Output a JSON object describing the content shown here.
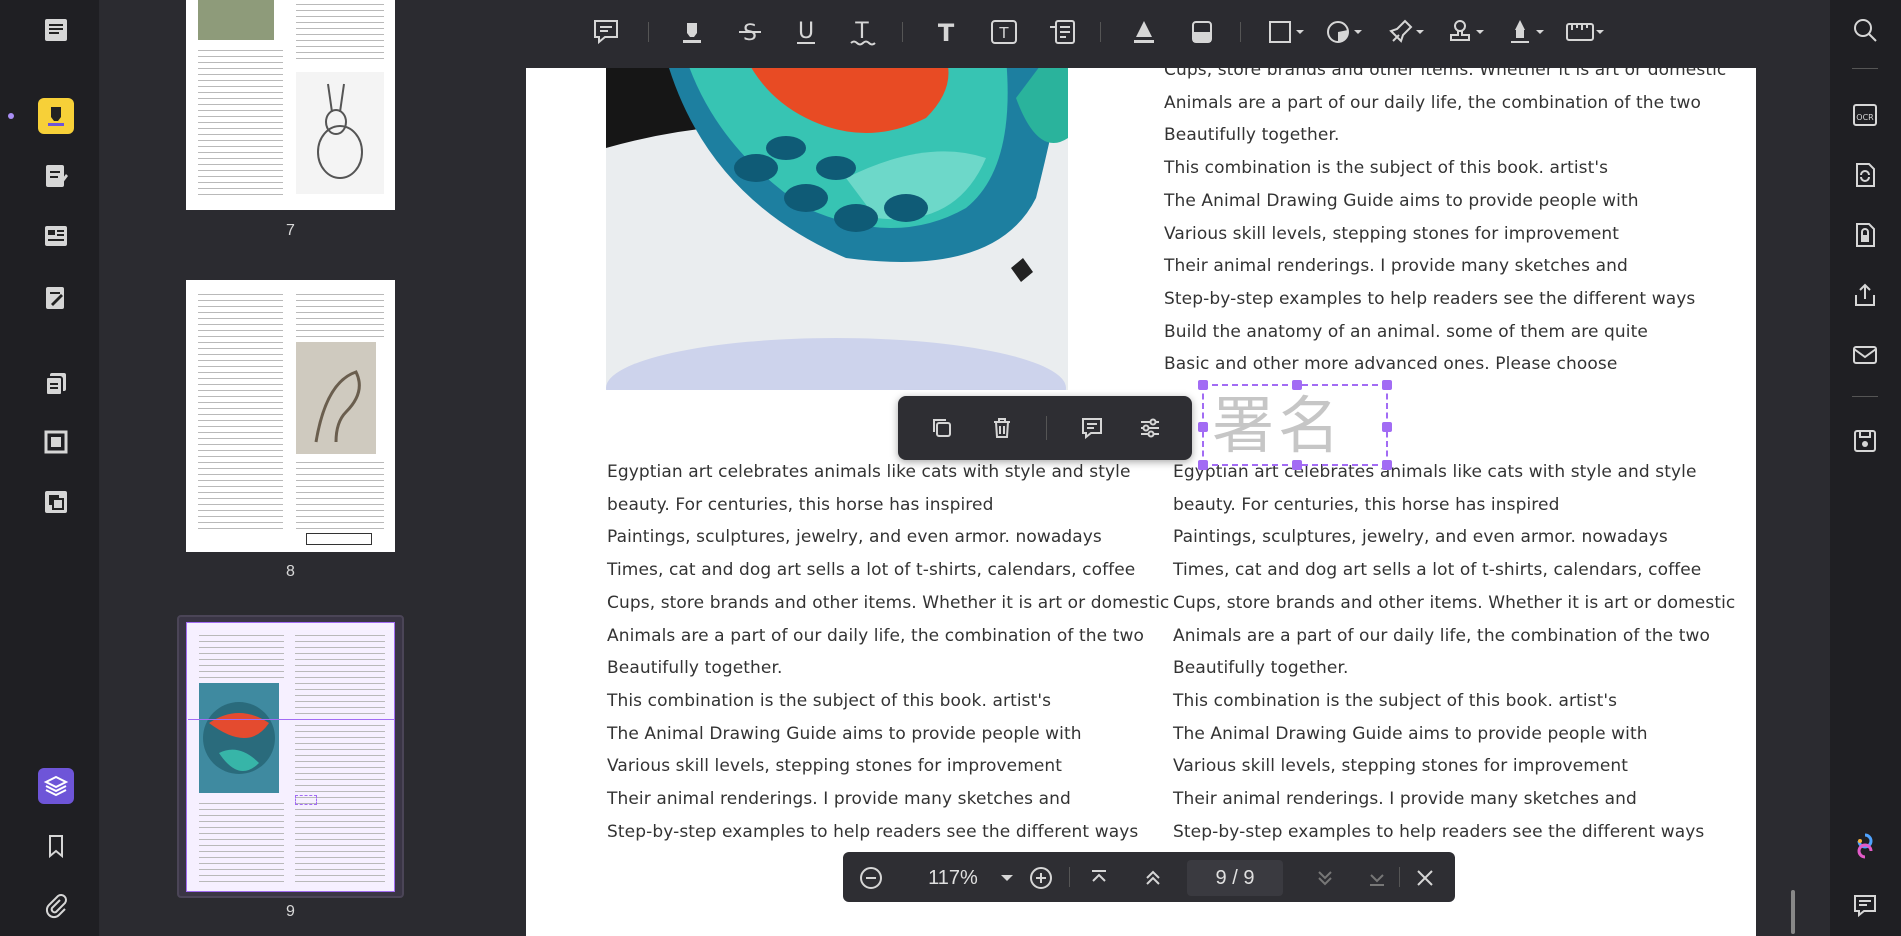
{
  "thumbnails": [
    {
      "page": "7"
    },
    {
      "page": "8"
    },
    {
      "page": "9"
    }
  ],
  "document": {
    "right_column_top": [
      "Cups, store brands and other items. Whether it is art or domestic",
      "Animals are a part of our daily life, the combination of the two",
      "Beautifully together.",
      "This combination is the subject of this book. artist's",
      "The Animal Drawing Guide aims to provide people with",
      "Various skill levels, stepping stones for improvement",
      "Their animal renderings. I provide many sketches and",
      "Step-by-step examples to help readers see the different ways",
      "Build the anatomy of an animal. some of them are quite",
      "Basic and other more advanced ones. Please choose"
    ],
    "left_column_bottom": [
      "Egyptian art celebrates animals like cats with style and style",
      "beauty. For centuries, this horse has inspired",
      "Paintings, sculptures, jewelry, and even armor. nowadays",
      "Times, cat and dog art sells a lot of t-shirts, calendars, coffee",
      "Cups, store brands and other items. Whether it is art or domestic",
      "Animals are a part of our daily life, the combination of the two",
      "Beautifully together.",
      "This combination is the subject of this book. artist's",
      "The Animal Drawing Guide aims to provide people with",
      "Various skill levels, stepping stones for improvement",
      "Their animal renderings. I provide many sketches and",
      "Step-by-step examples to help readers see the different ways"
    ],
    "right_column_bottom": [
      "Egyptian art celebrates animals like cats with style and style",
      "beauty. For centuries, this horse has inspired",
      "Paintings, sculptures, jewelry, and even armor. nowadays",
      "Times, cat and dog art sells a lot of t-shirts, calendars, coffee",
      "Cups, store brands and other items. Whether it is art or domestic",
      "Animals are a part of our daily life, the combination of the two",
      "Beautifully together.",
      "This combination is the subject of this book. artist's",
      "The Animal Drawing Guide aims to provide people with",
      "Various skill levels, stepping stones for improvement",
      "Their animal renderings. I provide many sketches and",
      "Step-by-step examples to help readers see the different ways"
    ],
    "signature_text": "署名"
  },
  "nav": {
    "zoom": "117%",
    "page_indicator": "9 / 9"
  },
  "colors": {
    "accent": "#a26cf4",
    "highlight_tool": "#f7d038",
    "layers_tool": "#6e55d8",
    "app_bg": "#2b2b30",
    "rail_bg": "#1f1f23"
  },
  "icons": {
    "left_rail": [
      "reader-icon",
      "highlighter-icon",
      "edit-icon",
      "form-icon",
      "sign-edit-icon",
      "organize-icon",
      "crop-icon",
      "watermark-icon",
      "layers-icon",
      "bookmark-icon",
      "attachment-icon"
    ],
    "toolbar": [
      "comment-icon",
      "highlight-icon",
      "strikethrough-icon",
      "underline-icon",
      "squiggly-icon",
      "text-icon",
      "textbox-icon",
      "callout-icon",
      "area-highlight-icon",
      "eraser-icon",
      "shape-icon",
      "sticker-icon",
      "pin-icon",
      "stamp-icon",
      "signature-icon",
      "measure-icon"
    ],
    "right_rail": [
      "search-icon",
      "ocr-icon",
      "convert-icon",
      "protect-icon",
      "share-icon",
      "email-icon",
      "save-icon",
      "ai-assistant-icon",
      "comments-icon"
    ]
  }
}
